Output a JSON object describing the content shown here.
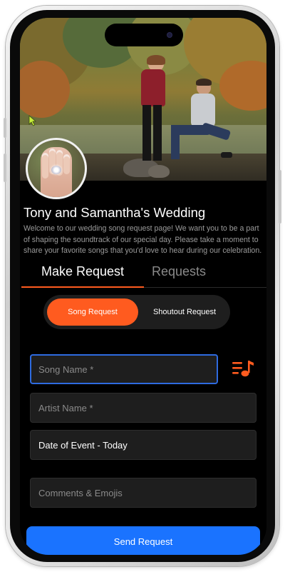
{
  "event": {
    "title": "Tony and Samantha's Wedding",
    "description": "Welcome to our wedding song request page! We want you to be a part of shaping the soundtrack of our special day. Please take a moment to share your favorite songs that you'd love to hear during our celebration."
  },
  "tabs": [
    {
      "label": "Make Request",
      "active": true
    },
    {
      "label": "Requests",
      "active": false
    }
  ],
  "request_type": {
    "options": [
      "Song Request",
      "Shoutout Request"
    ],
    "selected": "Song Request"
  },
  "form": {
    "song_name": {
      "placeholder": "Song Name *",
      "value": ""
    },
    "artist_name": {
      "placeholder": "Artist Name *",
      "value": ""
    },
    "date": {
      "value": "Date of Event - Today"
    },
    "comments": {
      "placeholder": "Comments & Emojis",
      "value": ""
    }
  },
  "actions": {
    "send_label": "Send Request"
  },
  "icons": {
    "playlist": "playlist-icon"
  },
  "colors": {
    "accent": "#ff5b1f",
    "primary": "#1a73ff",
    "focus": "#2e6be0",
    "background": "#000000"
  }
}
